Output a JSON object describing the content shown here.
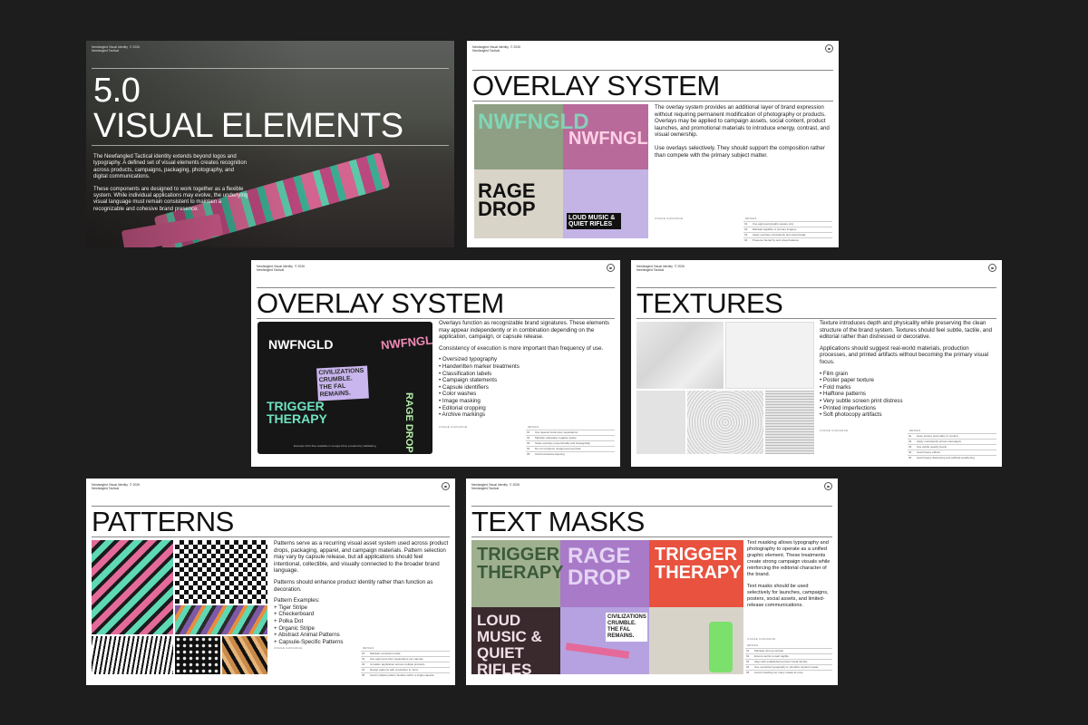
{
  "header": {
    "brand": "Newfangled Visual Identity Newfangled Tactical",
    "year": "© 2026"
  },
  "hero": {
    "title_line1": "5.0",
    "title_line2": "VISUAL ELEMENTS",
    "paragraph1": "The Newfangled Tactical identity extends beyond logos and typography. A defined set of visual elements creates recognition across products, campaigns, packaging, photography, and digital communications.",
    "paragraph2": "These components are designed to work together as a flexible system. While individual applications may evolve, the underlying visual language must remain consistent to maintain a recognizable and cohesive brand presence."
  },
  "overlay1": {
    "title": "OVERLAY SYSTEM",
    "paragraph1": "The overlay system provides an additional layer of brand expression without requiring permanent modification of photography or products. Overlays may be applied to campaign assets, social content, product launches, and promotional materials to introduce energy, contrast, and visual ownership.",
    "paragraph2": "Use overlays selectively. They should support the composition rather than compete with the primary subject matter.",
    "art_labels": [
      "NWFNGLD",
      "NWFNGLD",
      "RAGE DROP",
      "LOUD MUSIC & QUIET RIFLES"
    ],
    "meta_left": "USAGE GUIDANCE",
    "meta_right": "DETAILS",
    "rows": [
      "Use approved graphic assets only",
      "Maintain legibility of primary imagery",
      "Apply overlays consistently and intentionally",
      "Preserve hierarchy and visual balance"
    ]
  },
  "overlay2": {
    "title": "OVERLAY SYSTEM",
    "paragraph1": "Overlays function as recognizable brand signatures. These elements may appear independently or in combination depending on the application, campaign, or capsule release.",
    "paragraph2": "Consistency of execution is more important than frequency of use.",
    "bullets": [
      "Oversized typography",
      "Handwritten marker treatments",
      "Classification labels",
      "Campaign statements",
      "Capsule identifiers",
      "Color washes",
      "Image masking",
      "Editorial cropping",
      "Archive markings"
    ],
    "art_labels": [
      "NWFNGLD",
      "NWFNGLD",
      "CIVILIZATIONS CRUMBLE. THE FAL REMAINS.",
      "TRIGGER THERAPY",
      "RAGE DROP"
    ],
    "caption": "Example SVG files available in Google Drive provided by Halfbaking",
    "meta_left": "USAGE GUIDANCE",
    "meta_right": "DETAILS",
    "rows": [
      "Use layered tonal color separations",
      "Maintain adequate negative space",
      "Scale overlays proportionally and strategically",
      "Do not introduce unapproved symbols",
      "Avoid excessive layering"
    ]
  },
  "textures": {
    "title": "TEXTURES",
    "paragraph1": "Texture introduces depth and physicality while preserving the clean structure of the brand system. Textures should feel subtle, tactile, and editorial rather than distressed or decorative.",
    "paragraph2": "Applications should suggest real-world materials, production processes, and printed artifacts without becoming the primary visual focus.",
    "bullets": [
      "Film grain",
      "Poster paper texture",
      "Fold marks",
      "Halftone patterns",
      "Very subtle screen print distress",
      "Printed imperfections",
      "Soft photocopy artifacts"
    ],
    "meta_left": "USAGE GUIDANCE",
    "meta_right": "DETAILS",
    "rows": [
      "Keep texture secondary to content",
      "Apply consistently across campaigns",
      "Use subtle opacity levels",
      "Avoid heavy effects",
      "Avoid heavy distressing and artificial weathering"
    ]
  },
  "patterns": {
    "title": "PATTERNS",
    "paragraph1": "Patterns serve as a recurring visual asset system used across product drops, packaging, apparel, and campaign materials. Pattern selection may vary by capsule release, but all applications should feel intentional, collectible, and visually connected to the broader brand language.",
    "paragraph2": "Patterns should enhance product identity rather than function as decoration.",
    "examples_label": "Pattern Examples:",
    "examples": [
      "+ Tiger Stripe",
      "+ Checkerboard",
      "+ Polka Dot",
      "+ Organic Stripe",
      "+ Abstract Animal Patterns",
      "+ Capsule-Specific Patterns"
    ],
    "meta_left": "USAGE GUIDANCE",
    "meta_right": "DETAILS",
    "rows": [
      "Maintain consistent scale",
      "Use approved color separations per capsule",
      "Consider application across multiple products",
      "Design patterns with production in mind",
      "Avoid multiple pattern families within a single capsule"
    ]
  },
  "textmasks": {
    "title": "TEXT MASKS",
    "paragraph1": "Text masking allows typography and photography to operate as a unified graphic element. These treatments create strong campaign visuals while reinforcing the editorial character of the brand.",
    "paragraph2": "Text masks should be used selectively for launches, campaigns, posters, social assets, and limited-release communications.",
    "art_labels": [
      "TRIGGER THERAPY",
      "RAGE DROP",
      "TRIGGER THERAPY",
      "LOUD MUSIC & QUIET RIFLES",
      "CIVILIZATIONS CRUMBLE. THE FAL REMAINS."
    ],
    "meta_left": "USAGE GUIDANCE",
    "meta_right": "DETAILS",
    "rows": [
      "Maintain strong contrast",
      "Ensure words remain legible",
      "Align with established product visual identity",
      "Use oversized typography to prioritize dynamic areas",
      "Avoid crowding too many masks at once"
    ]
  },
  "colors": {
    "background": "#1d1d1d",
    "pink": "#e46a9a",
    "mint": "#5fd8b4",
    "lavender": "#b9a4de",
    "dark": "#161616"
  }
}
